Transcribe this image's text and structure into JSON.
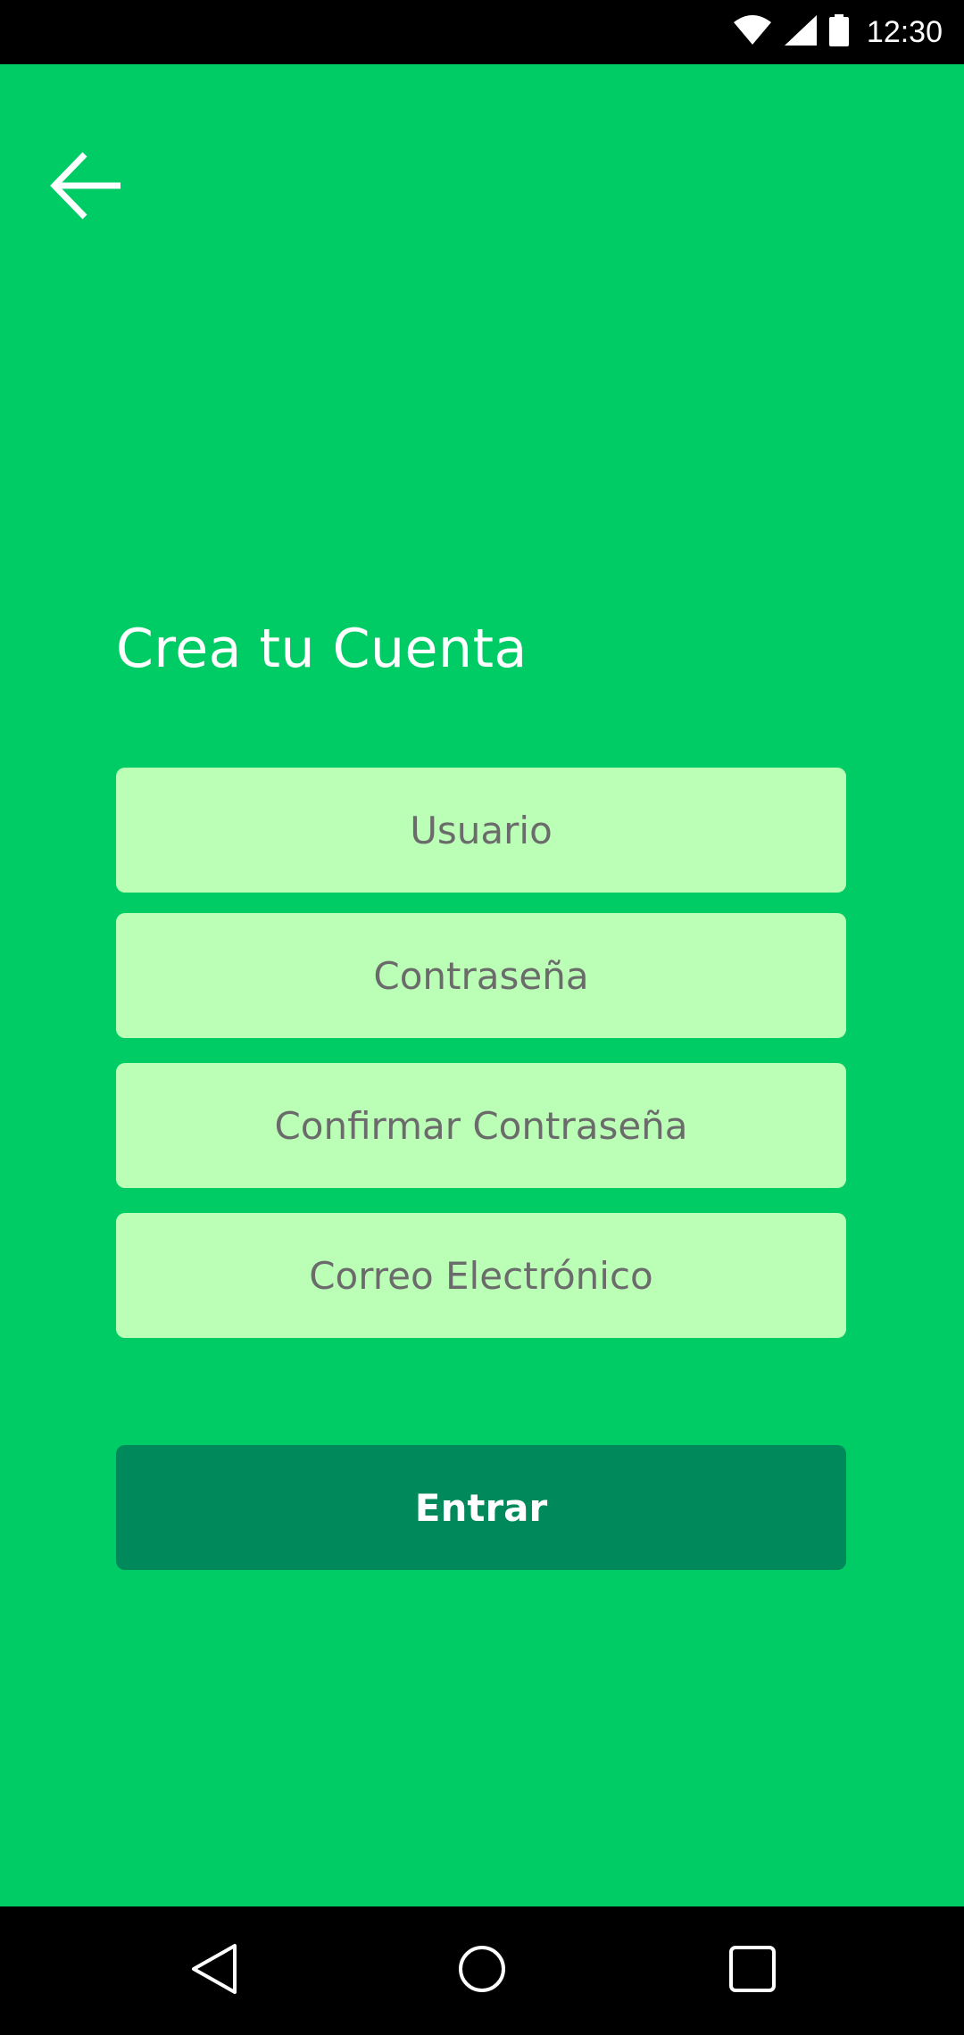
{
  "status_bar": {
    "time": "12:30",
    "icons": [
      "wifi-icon",
      "signal-icon",
      "battery-icon"
    ]
  },
  "header": {
    "back_icon": "arrow-left-icon"
  },
  "form": {
    "title": "Crea tu Cuenta",
    "fields": [
      {
        "placeholder": "Usuario",
        "value": ""
      },
      {
        "placeholder": "Contraseña",
        "value": ""
      },
      {
        "placeholder": "Confirmar Contraseña",
        "value": ""
      },
      {
        "placeholder": "Correo Electrónico",
        "value": ""
      }
    ],
    "submit_label": "Entrar"
  },
  "nav_bar": {
    "buttons": [
      "back-triangle-icon",
      "home-circle-icon",
      "recents-square-icon"
    ]
  },
  "colors": {
    "background": "#00CC66",
    "field_background": "#BBFFB7",
    "button_background": "#00895A",
    "text_white": "#FFFFFF",
    "placeholder_text": "#6B6B6B"
  }
}
